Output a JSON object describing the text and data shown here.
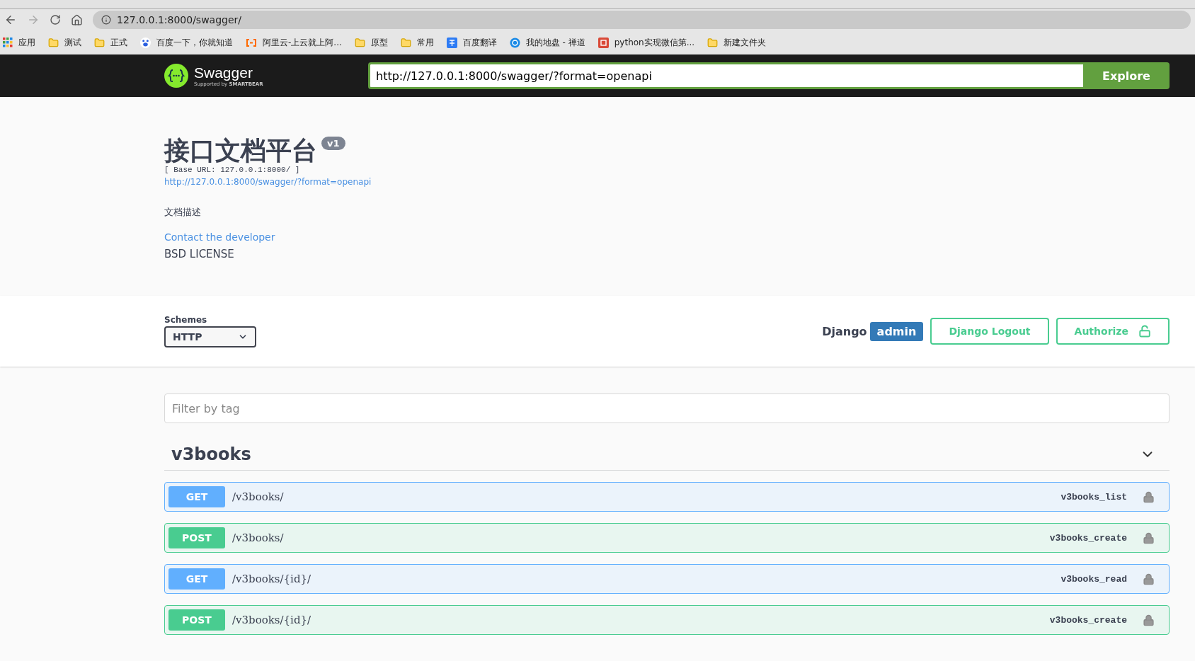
{
  "browser": {
    "address": "127.0.0.1:8000/swagger/",
    "bookmarks": [
      {
        "kind": "apps",
        "label": "应用"
      },
      {
        "kind": "folder",
        "label": "测试"
      },
      {
        "kind": "folder",
        "label": "正式"
      },
      {
        "kind": "paw",
        "label": "百度一下，你就知道"
      },
      {
        "kind": "cloud",
        "label": "阿里云-上云就上阿..."
      },
      {
        "kind": "folder",
        "label": "原型"
      },
      {
        "kind": "folder",
        "label": "常用"
      },
      {
        "kind": "translate",
        "label": "百度翻译"
      },
      {
        "kind": "disk",
        "label": "我的地盘 - 禅道"
      },
      {
        "kind": "jian",
        "label": "python实现微信第..."
      },
      {
        "kind": "folder",
        "label": "新建文件夹"
      }
    ]
  },
  "topbar": {
    "logo_text": "Swagger",
    "logo_sub": "Supported by",
    "logo_brand": "SMARTBEAR",
    "url": "http://127.0.0.1:8000/swagger/?format=openapi",
    "explore": "Explore"
  },
  "info": {
    "title": "接口文档平台",
    "version": "v1",
    "base_url": "[ Base URL: 127.0.0.1:8000/ ]",
    "spec_link": "http://127.0.0.1:8000/swagger/?format=openapi",
    "description": "文档描述",
    "contact": "Contact the developer",
    "license": "BSD LICENSE"
  },
  "schemes": {
    "label": "Schemes",
    "value": "HTTP"
  },
  "auth": {
    "framework": "Django",
    "user": "admin",
    "logout": "Django Logout",
    "authorize": "Authorize"
  },
  "filter": {
    "placeholder": "Filter by tag"
  },
  "tag": {
    "name": "v3books",
    "expanded": true
  },
  "operations": [
    {
      "kind": "get",
      "method": "GET",
      "path": "/v3books/",
      "operation_id": "v3books_list"
    },
    {
      "kind": "post",
      "method": "POST",
      "path": "/v3books/",
      "operation_id": "v3books_create"
    },
    {
      "kind": "get",
      "method": "GET",
      "path": "/v3books/{id}/",
      "operation_id": "v3books_read"
    },
    {
      "kind": "post",
      "method": "POST",
      "path": "/v3books/{id}/",
      "operation_id": "v3books_create"
    }
  ]
}
